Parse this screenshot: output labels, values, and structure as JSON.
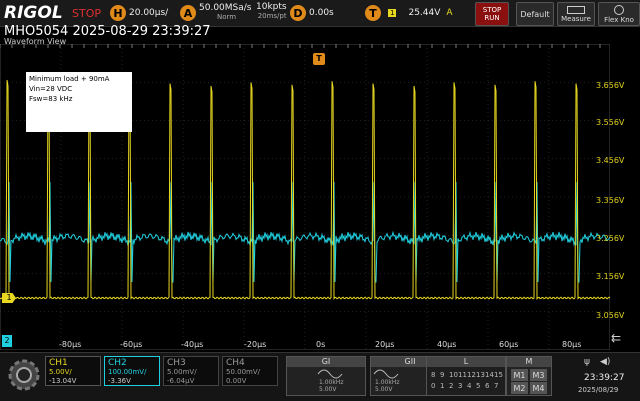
{
  "topbar": {
    "logo": "RIGOL",
    "run_state": "STOP",
    "h_icon": "H",
    "timebase": "20.00μs/",
    "a_icon": "A",
    "sample_rate": "50.00MSa/s",
    "acq_mode": "Norm",
    "mem_depth": "10kpts",
    "mem_time": "20ms/pt",
    "d_icon": "D",
    "delay": "0.00s",
    "t_icon": "T",
    "trig_src": "1",
    "trig_level": "25.44V",
    "trig_type": "A",
    "stop_run_label_1": "STOP",
    "stop_run_label_2": "RUN",
    "default_label": "Default",
    "measure_label": "Measure",
    "flex_label": "Flex Kno"
  },
  "title": "MHO5054 2025-08-29 23:39:27",
  "view_label": "Waveform View",
  "trigger_marker": "T",
  "notes": [
    "Minimum load + 90mA",
    "Vin=28 VDC",
    "Fsw=83 kHz"
  ],
  "vscale": [
    "3.656V",
    "3.556V",
    "3.456V",
    "3.356V",
    "3.256V",
    "3.156V",
    "3.056V"
  ],
  "tscale": [
    "-80μs",
    "-60μs",
    "-40μs",
    "-20μs",
    "0s",
    "20μs",
    "40μs",
    "60μs",
    "80μs"
  ],
  "ch1_marker": "1",
  "ch2_marker": "2",
  "channels": [
    {
      "name": "CH1",
      "scale": "5.00V/",
      "offset": "-13.04V",
      "color": "#e8d820"
    },
    {
      "name": "CH2",
      "scale": "100.00mV/",
      "offset": "-3.36V",
      "color": "#20d0e0"
    },
    {
      "name": "CH3",
      "scale": "5.00mV/",
      "offset": "-6.04μV",
      "color": "#999999"
    },
    {
      "name": "CH4",
      "scale": "50.00mV/",
      "offset": "0.00V",
      "color": "#999999"
    }
  ],
  "gen1": {
    "label": "GI",
    "freq": "1.00kHz",
    "amp": "5.00V"
  },
  "gen2": {
    "label": "GII",
    "freq": "1.00kHz",
    "amp": "5.00V"
  },
  "logic": {
    "label": "L",
    "nums": [
      "8",
      "9",
      "10",
      "11",
      "12",
      "13",
      "14",
      "15",
      "0",
      "1",
      "2",
      "3",
      "4",
      "5",
      "6",
      "7"
    ]
  },
  "math": {
    "label": "M",
    "buttons": [
      "M1",
      "M3",
      "M2",
      "M4"
    ]
  },
  "clock": {
    "time": "23:39:27",
    "date": "2025/08/29"
  },
  "colors": {
    "ch1": "#e8d820",
    "ch2": "#20d0e0",
    "trigger": "#e08a1a"
  }
}
